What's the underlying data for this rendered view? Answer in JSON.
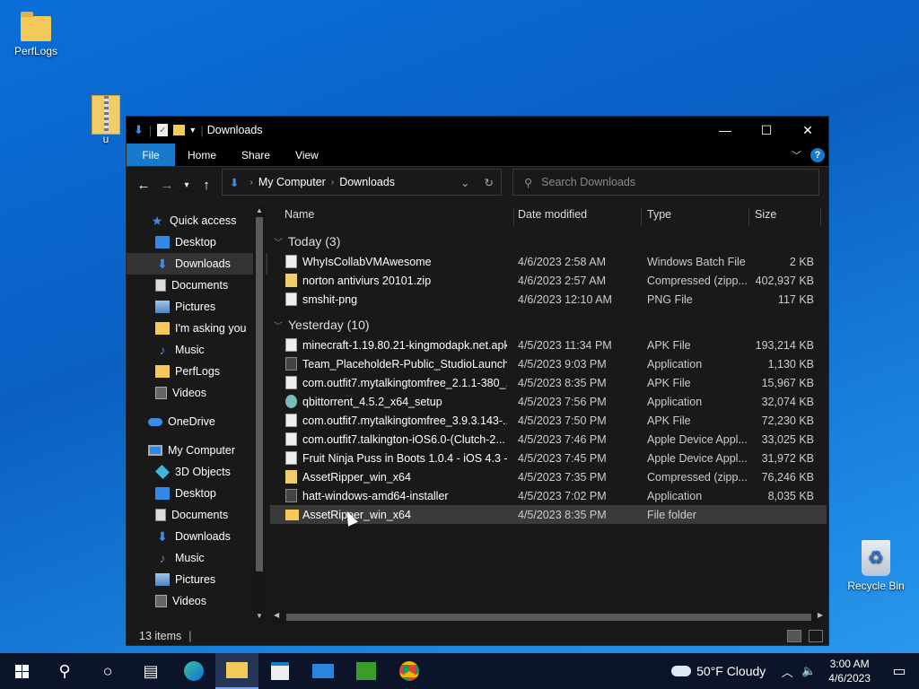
{
  "desktop": {
    "icons": [
      {
        "label": "PerfLogs",
        "icon": "folder-icon"
      },
      {
        "label": "u",
        "icon": "zip-folder-icon"
      },
      {
        "label": "Recycle Bin",
        "icon": "recycle-bin-icon"
      }
    ]
  },
  "window": {
    "title": "Downloads",
    "controls": {
      "minimize": "—",
      "maximize": "☐",
      "close": "✕"
    },
    "ribbon_tabs": [
      "File",
      "Home",
      "Share",
      "View"
    ],
    "help": "?",
    "address": {
      "segments": [
        "My Computer",
        "Downloads"
      ]
    },
    "search": {
      "placeholder": "Search Downloads"
    }
  },
  "nav_pane": {
    "items": [
      {
        "label": "Quick access",
        "icon": "star-icon",
        "indent": 0
      },
      {
        "label": "Desktop",
        "icon": "desktop-icon",
        "pinned": true
      },
      {
        "label": "Downloads",
        "icon": "download-icon",
        "pinned": true,
        "selected": true
      },
      {
        "label": "Documents",
        "icon": "document-icon",
        "pinned": true
      },
      {
        "label": "Pictures",
        "icon": "pictures-icon",
        "pinned": true
      },
      {
        "label": "I'm  asking you",
        "icon": "folder-icon"
      },
      {
        "label": "Music",
        "icon": "music-icon"
      },
      {
        "label": "PerfLogs",
        "icon": "folder-icon"
      },
      {
        "label": "Videos",
        "icon": "video-icon"
      },
      {
        "label": "OneDrive",
        "icon": "cloud-icon"
      },
      {
        "label": "My Computer",
        "icon": "computer-icon"
      },
      {
        "label": "3D Objects",
        "icon": "3d-objects-icon"
      },
      {
        "label": "Desktop",
        "icon": "desktop-icon"
      },
      {
        "label": "Documents",
        "icon": "document-icon"
      },
      {
        "label": "Downloads",
        "icon": "download-icon"
      },
      {
        "label": "Music",
        "icon": "music-icon"
      },
      {
        "label": "Pictures",
        "icon": "pictures-icon"
      },
      {
        "label": "Videos",
        "icon": "video-icon"
      }
    ]
  },
  "columns": [
    "Name",
    "Date modified",
    "Type",
    "Size"
  ],
  "groups": [
    {
      "label": "Today (3)",
      "files": [
        {
          "name": "WhyIsCollabVMAwesome",
          "date": "4/6/2023 2:58 AM",
          "type": "Windows Batch File",
          "size": "2 KB",
          "icon": "file"
        },
        {
          "name": "norton antiviurs 20101.zip",
          "date": "4/6/2023 2:57 AM",
          "type": "Compressed (zipp...",
          "size": "402,937 KB",
          "icon": "zip"
        },
        {
          "name": "smshit-png",
          "date": "4/6/2023 12:10 AM",
          "type": "PNG File",
          "size": "117 KB",
          "icon": "file"
        }
      ]
    },
    {
      "label": "Yesterday (10)",
      "files": [
        {
          "name": "minecraft-1.19.80.21-kingmodapk.net.apk",
          "date": "4/5/2023 11:34 PM",
          "type": "APK File",
          "size": "193,214 KB",
          "icon": "file"
        },
        {
          "name": "Team_PlaceholdeR-Public_StudioLaunch...",
          "date": "4/5/2023 9:03 PM",
          "type": "Application",
          "size": "1,130 KB",
          "icon": "app"
        },
        {
          "name": "com.outfit7.mytalkingtomfree_2.1.1-380_...",
          "date": "4/5/2023 8:35 PM",
          "type": "APK File",
          "size": "15,967 KB",
          "icon": "file"
        },
        {
          "name": "qbittorrent_4.5.2_x64_setup",
          "date": "4/5/2023 7:56 PM",
          "type": "Application",
          "size": "32,074 KB",
          "icon": "qb"
        },
        {
          "name": "com.outfit7.mytalkingtomfree_3.9.3.143-...",
          "date": "4/5/2023 7:50 PM",
          "type": "APK File",
          "size": "72,230 KB",
          "icon": "file"
        },
        {
          "name": "com.outfit7.talkington-iOS6.0-(Clutch-2...",
          "date": "4/5/2023 7:46 PM",
          "type": "Apple Device Appl...",
          "size": "33,025 KB",
          "icon": "file"
        },
        {
          "name": "Fruit Ninja Puss in Boots 1.0.4 - iOS 4.3 - [...",
          "date": "4/5/2023 7:45 PM",
          "type": "Apple Device Appl...",
          "size": "31,972 KB",
          "icon": "file"
        },
        {
          "name": "AssetRipper_win_x64",
          "date": "4/5/2023 7:35 PM",
          "type": "Compressed (zipp...",
          "size": "76,246 KB",
          "icon": "zip"
        },
        {
          "name": "hatt-windows-amd64-installer",
          "date": "4/5/2023 7:02 PM",
          "type": "Application",
          "size": "8,035 KB",
          "icon": "app"
        },
        {
          "name": "AssetRipper_win_x64",
          "date": "4/5/2023 8:35 PM",
          "type": "File folder",
          "size": "",
          "icon": "folder",
          "selected": true
        }
      ]
    }
  ],
  "status": {
    "items": "13 items"
  },
  "taskbar": {
    "apps": [
      "start-icon",
      "search-icon",
      "cortana-icon",
      "task-view-icon",
      "edge-icon",
      "file-explorer-icon",
      "store-icon",
      "mail-icon",
      "minecraft-icon",
      "chrome-icon"
    ],
    "weather": "50°F  Cloudy",
    "time": "3:00 AM",
    "date": "4/6/2023"
  }
}
